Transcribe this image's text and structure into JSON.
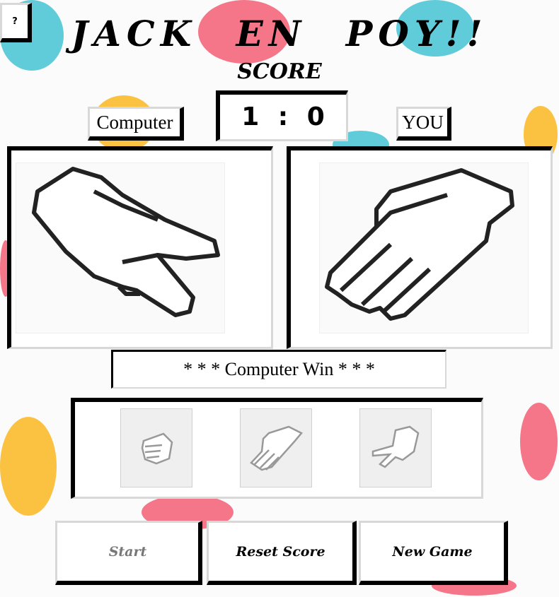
{
  "app": {
    "title": "JACK EN POY!!",
    "score_heading": "SCORE",
    "help_label": "?"
  },
  "score": {
    "computer_label": "Computer",
    "player_label": "YOU",
    "display": "1 : 0",
    "computer": 1,
    "player": 0
  },
  "hands": {
    "computer": "scissors-hand-icon",
    "player": "paper-hand-icon"
  },
  "result": "* * * Computer Win * * *",
  "choices": [
    "rock",
    "paper",
    "scissors"
  ],
  "buttons": {
    "start": "Start",
    "reset": "Reset Score",
    "new_game": "New Game"
  },
  "colors": {
    "pink": "#f4677c",
    "teal": "#4fc6d6",
    "yellow": "#f9bb2b"
  }
}
